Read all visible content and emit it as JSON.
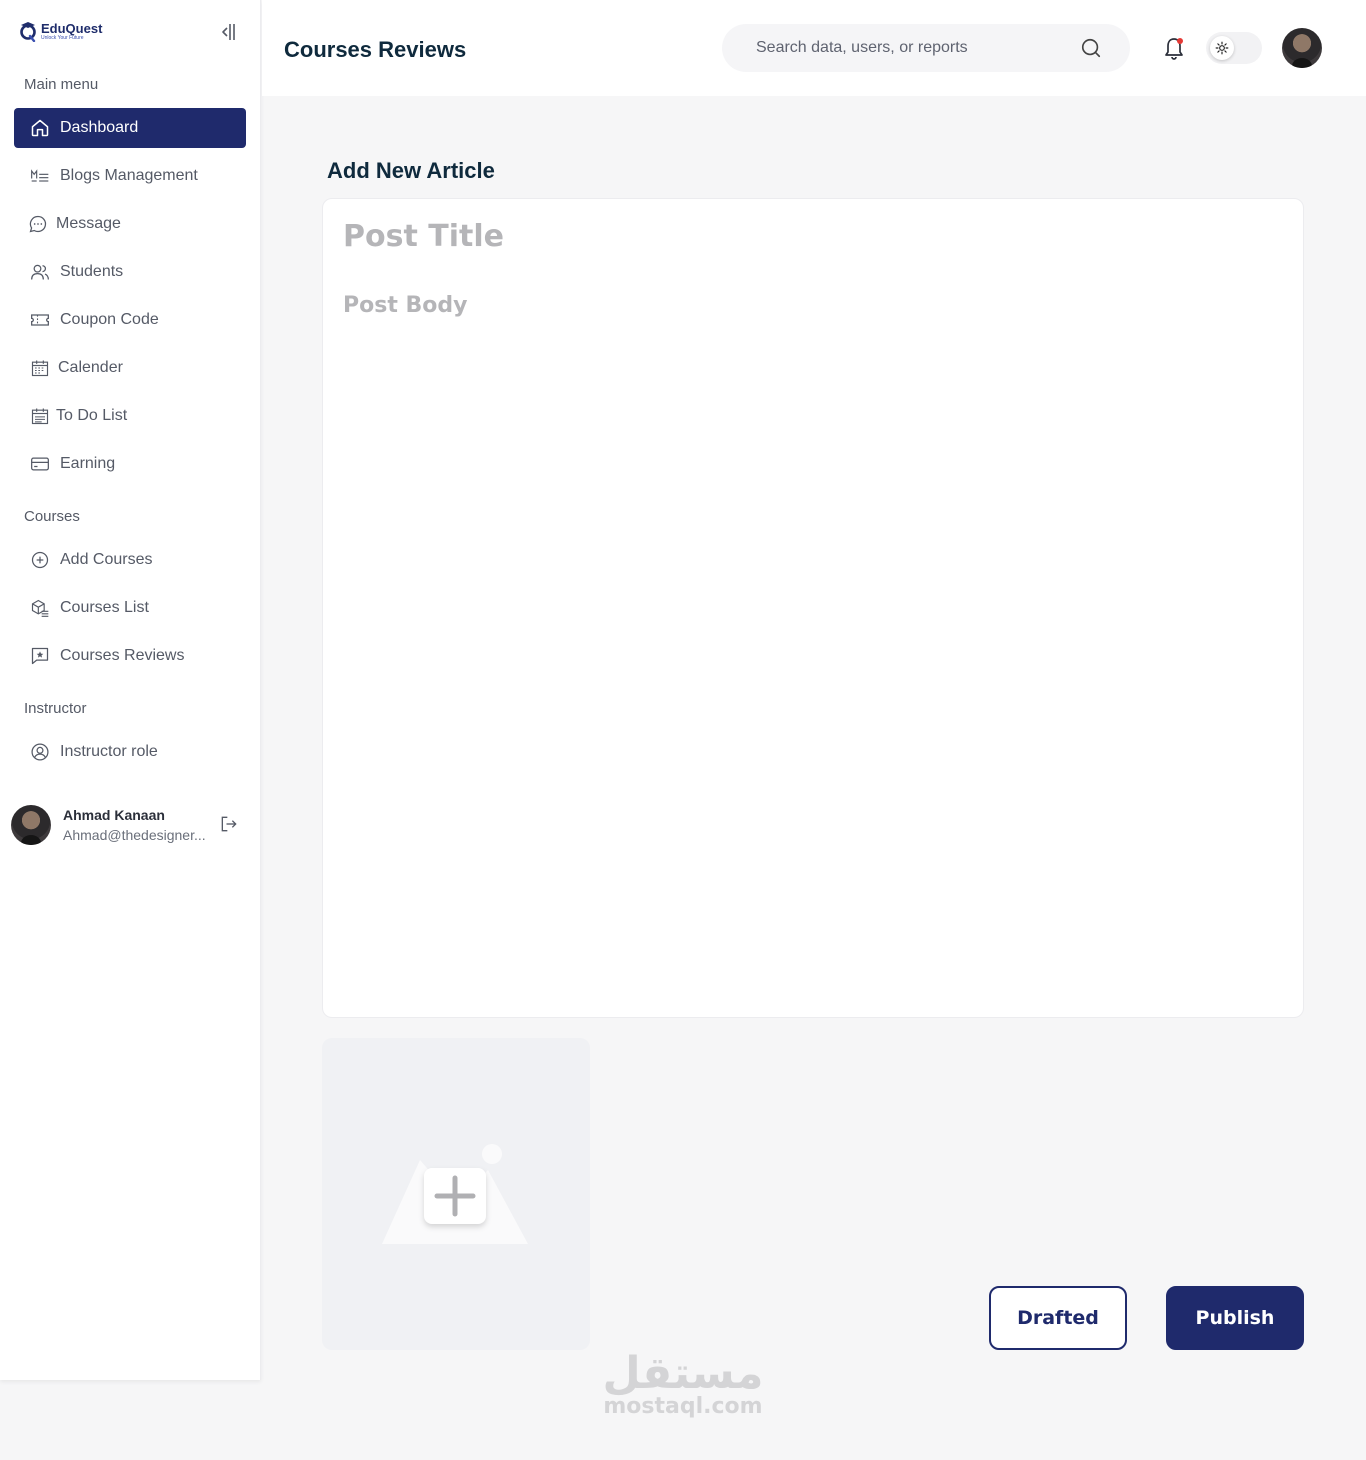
{
  "app": {
    "logo_name": "EduQuest",
    "logo_tagline": "Unlock Your Future"
  },
  "sidebar": {
    "main_menu_label": "Main menu",
    "main_items": [
      {
        "label": "Dashboard",
        "icon": "home-icon",
        "active": true
      },
      {
        "label": "Blogs Management",
        "icon": "markdown-list-icon",
        "active": false
      },
      {
        "label": "Message",
        "icon": "chat-bubble-icon",
        "active": false
      },
      {
        "label": "Students",
        "icon": "users-icon",
        "active": false
      },
      {
        "label": "Coupon Code",
        "icon": "ticket-icon",
        "active": false
      },
      {
        "label": "Calender",
        "icon": "calendar-icon",
        "active": false
      },
      {
        "label": "To Do List",
        "icon": "calendar-list-icon",
        "active": false
      },
      {
        "label": "Earning",
        "icon": "credit-card-icon",
        "active": false
      }
    ],
    "courses_label": "Courses",
    "course_items": [
      {
        "label": "Add Courses",
        "icon": "plus-circle-icon"
      },
      {
        "label": "Courses List",
        "icon": "box-list-icon"
      },
      {
        "label": "Courses Reviews",
        "icon": "star-message-icon"
      }
    ],
    "instructor_label": "Instructor",
    "instructor_items": [
      {
        "label": "Instructor role",
        "icon": "user-circle-icon"
      }
    ],
    "user": {
      "name": "Ahmad Kanaan",
      "email": "Ahmad@thedesigner..."
    }
  },
  "header": {
    "title": "Courses Reviews",
    "search_placeholder": "Search data, users, or reports",
    "theme": "light"
  },
  "main": {
    "heading": "Add New Article",
    "post_title_placeholder": "Post Title",
    "post_body_placeholder": "Post Body",
    "drafted_label": "Drafted",
    "publish_label": "Publish"
  },
  "watermark": {
    "arabic": "مستقل",
    "latin": "mostaql.com"
  },
  "colors": {
    "primary": "#1f2a6c",
    "heading": "#0f2a3d",
    "notification_dot": "#e53935"
  }
}
